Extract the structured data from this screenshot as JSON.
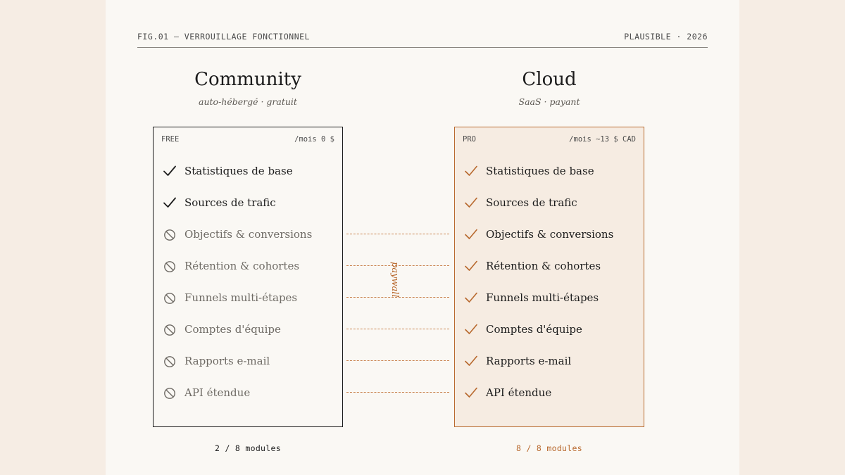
{
  "header": {
    "fig_label": "FIG.01 — VERROUILLAGE FONCTIONNEL",
    "meta": "PLAUSIBLE · 2026"
  },
  "colors": {
    "accent": "#b8692e",
    "ink": "#1c1c1c",
    "muted": "#6e6a64",
    "paper": "#faf8f4",
    "background": "#f6ede4",
    "pro_fill": "#f6ece2"
  },
  "community": {
    "title": "Community",
    "subtitle": "auto-hébergé · gratuit",
    "tier": "FREE",
    "price": "/mois 0 $",
    "count": "2 / 8 modules",
    "features": [
      {
        "label": "Statistiques de base",
        "included": true
      },
      {
        "label": "Sources de trafic",
        "included": true
      },
      {
        "label": "Objectifs & conversions",
        "included": false
      },
      {
        "label": "Rétention & cohortes",
        "included": false
      },
      {
        "label": "Funnels multi-étapes",
        "included": false
      },
      {
        "label": "Comptes d'équipe",
        "included": false
      },
      {
        "label": "Rapports e-mail",
        "included": false
      },
      {
        "label": "API étendue",
        "included": false
      }
    ]
  },
  "cloud": {
    "title": "Cloud",
    "subtitle": "SaaS · payant",
    "tier": "PRO",
    "price": "/mois ~13 $ CAD",
    "count": "8 / 8 modules",
    "features": [
      {
        "label": "Statistiques de base",
        "included": true
      },
      {
        "label": "Sources de trafic",
        "included": true
      },
      {
        "label": "Objectifs & conversions",
        "included": true
      },
      {
        "label": "Rétention & cohortes",
        "included": true
      },
      {
        "label": "Funnels multi-étapes",
        "included": true
      },
      {
        "label": "Comptes d'équipe",
        "included": true
      },
      {
        "label": "Rapports e-mail",
        "included": true
      },
      {
        "label": "API étendue",
        "included": true
      }
    ]
  },
  "paywall_label": "paywall"
}
